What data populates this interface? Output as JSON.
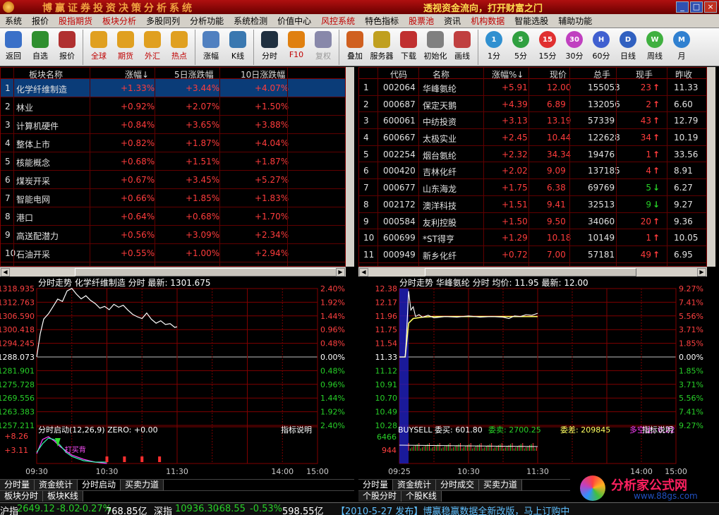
{
  "title": {
    "app": "博赢证券投资决策分析系统",
    "slogan": "透视资金流向，打开财富之门"
  },
  "window_buttons": [
    "_",
    "□",
    "×"
  ],
  "menu": [
    {
      "label": "系统",
      "red": false
    },
    {
      "label": "报价",
      "red": false
    },
    {
      "label": "股指期货",
      "red": true
    },
    {
      "label": "板块分析",
      "red": true
    },
    {
      "label": "多股同列",
      "red": false
    },
    {
      "label": "分析功能",
      "red": false
    },
    {
      "label": "系统检测",
      "red": false
    },
    {
      "label": "价值中心",
      "red": false
    },
    {
      "label": "风控系统",
      "red": true
    },
    {
      "label": "特色指标",
      "red": false
    },
    {
      "label": "股票池",
      "red": true
    },
    {
      "label": "资讯",
      "red": false
    },
    {
      "label": "机构数据",
      "red": true
    },
    {
      "label": "智能选股",
      "red": false
    },
    {
      "label": "辅助功能",
      "red": false
    }
  ],
  "toolbar": [
    {
      "label": "返回",
      "icon": "back-icon",
      "color": "#3a70c8"
    },
    {
      "label": "自选",
      "icon": "star-list-icon",
      "color": "#2f8f2f"
    },
    {
      "label": "报价",
      "icon": "quote-icon",
      "color": "#b03030"
    },
    {
      "sep": true
    },
    {
      "label": "全球",
      "icon": "globe-icon",
      "color": "#e0a020",
      "red": true
    },
    {
      "label": "期货",
      "icon": "futures-icon",
      "color": "#e0a020",
      "red": true
    },
    {
      "label": "外汇",
      "icon": "forex-icon",
      "color": "#e0a020",
      "red": true
    },
    {
      "label": "热点",
      "icon": "hot-icon",
      "color": "#e0a020",
      "red": true
    },
    {
      "sep": true
    },
    {
      "label": "涨幅",
      "icon": "rise-icon",
      "color": "#5080c0"
    },
    {
      "label": "K线",
      "icon": "kline-icon",
      "color": "#3a78b0"
    },
    {
      "sep": true
    },
    {
      "label": "分时",
      "icon": "intraday-icon",
      "color": "#203040"
    },
    {
      "label": "F10",
      "icon": "f10-icon",
      "color": "#e08010",
      "red": true
    },
    {
      "label": "复权",
      "icon": "restore-icon",
      "color": "#8888aa",
      "dim": true
    },
    {
      "sep": true
    },
    {
      "label": "叠加",
      "icon": "overlay-icon",
      "color": "#d06020"
    },
    {
      "label": "服务器",
      "icon": "server-icon",
      "color": "#c0a020"
    },
    {
      "label": "下载",
      "icon": "download-icon",
      "color": "#c03030"
    },
    {
      "label": "初始化",
      "icon": "init-icon",
      "color": "#808080"
    },
    {
      "label": "画线",
      "icon": "draw-line-icon",
      "color": "#c04040"
    },
    {
      "sep": true
    },
    {
      "label": "1分",
      "icon": "period-1-icon",
      "color": "#3090d0",
      "text": "1"
    },
    {
      "label": "5分",
      "icon": "period-5-icon",
      "color": "#30a040",
      "text": "5"
    },
    {
      "label": "15分",
      "icon": "period-15-icon",
      "color": "#e03030",
      "text": "15"
    },
    {
      "label": "30分",
      "icon": "period-30-icon",
      "color": "#c040c0",
      "text": "30"
    },
    {
      "label": "60分",
      "icon": "period-60-icon",
      "color": "#4060d0",
      "text": "H"
    },
    {
      "label": "日线",
      "icon": "period-day-icon",
      "color": "#3060c0",
      "text": "D"
    },
    {
      "label": "周线",
      "icon": "period-week-icon",
      "color": "#40b040",
      "text": "W"
    },
    {
      "label": "月",
      "icon": "period-month-icon",
      "color": "#3080d0",
      "text": "M"
    }
  ],
  "sector_table": {
    "headers": [
      "板块名称",
      "涨幅↓",
      "5日涨跌幅",
      "10日涨跌幅"
    ],
    "rows": [
      {
        "no": "1",
        "name": "化学纤维制造",
        "chg": "+1.33%",
        "chg5": "+3.44%",
        "chg10": "+4.07%"
      },
      {
        "no": "2",
        "name": "林业",
        "chg": "+0.92%",
        "chg5": "+2.07%",
        "chg10": "+1.50%"
      },
      {
        "no": "3",
        "name": "计算机硬件",
        "chg": "+0.84%",
        "chg5": "+3.65%",
        "chg10": "+3.88%"
      },
      {
        "no": "4",
        "name": "整体上市",
        "chg": "+0.82%",
        "chg5": "+1.87%",
        "chg10": "+4.04%"
      },
      {
        "no": "5",
        "name": "核能概念",
        "chg": "+0.68%",
        "chg5": "+1.51%",
        "chg10": "+1.87%"
      },
      {
        "no": "6",
        "name": "煤炭开采",
        "chg": "+0.67%",
        "chg5": "+3.45%",
        "chg10": "+5.27%"
      },
      {
        "no": "7",
        "name": "智能电网",
        "chg": "+0.66%",
        "chg5": "+1.85%",
        "chg10": "+1.83%"
      },
      {
        "no": "8",
        "name": "港口",
        "chg": "+0.64%",
        "chg5": "+0.68%",
        "chg10": "+1.70%"
      },
      {
        "no": "9",
        "name": "高送配潜力",
        "chg": "+0.56%",
        "chg5": "+3.09%",
        "chg10": "+2.34%"
      },
      {
        "no": "10",
        "name": "石油开采",
        "chg": "+0.55%",
        "chg5": "+1.00%",
        "chg10": "+2.94%"
      }
    ]
  },
  "stock_table": {
    "headers": [
      "代码",
      "名称",
      "涨幅%↓",
      "现价",
      "总手",
      "现手",
      "昨收"
    ],
    "rows": [
      {
        "no": "1",
        "code": "002064",
        "name": "华峰氨纶",
        "chg": "+5.91",
        "price": "12.00",
        "vol": "155053",
        "cur": "23",
        "dir": "up",
        "prev": "11.33"
      },
      {
        "no": "2",
        "code": "000687",
        "name": "保定天鹅",
        "chg": "+4.39",
        "price": "6.89",
        "vol": "132056",
        "cur": "2",
        "dir": "up",
        "prev": "6.60"
      },
      {
        "no": "3",
        "code": "600061",
        "name": "中纺投资",
        "chg": "+3.13",
        "price": "13.19",
        "vol": "57339",
        "cur": "43",
        "dir": "up",
        "prev": "12.79"
      },
      {
        "no": "4",
        "code": "600667",
        "name": "太极实业",
        "chg": "+2.45",
        "price": "10.44",
        "vol": "122628",
        "cur": "34",
        "dir": "up",
        "prev": "10.19"
      },
      {
        "no": "5",
        "code": "002254",
        "name": "烟台氨纶",
        "chg": "+2.32",
        "price": "34.34",
        "vol": "19476",
        "cur": "1",
        "dir": "up",
        "prev": "33.56"
      },
      {
        "no": "6",
        "code": "000420",
        "name": "吉林化纤",
        "chg": "+2.02",
        "price": "9.09",
        "vol": "137185",
        "cur": "4",
        "dir": "up",
        "prev": "8.91"
      },
      {
        "no": "7",
        "code": "000677",
        "name": "山东海龙",
        "chg": "+1.75",
        "price": "6.38",
        "vol": "69769",
        "cur": "5",
        "dir": "down",
        "prev": "6.27"
      },
      {
        "no": "8",
        "code": "002172",
        "name": "澳洋科技",
        "chg": "+1.51",
        "price": "9.41",
        "vol": "32513",
        "cur": "9",
        "dir": "down",
        "prev": "9.27"
      },
      {
        "no": "9",
        "code": "000584",
        "name": "友利控股",
        "chg": "+1.50",
        "price": "9.50",
        "vol": "34060",
        "cur": "20",
        "dir": "up",
        "prev": "9.36"
      },
      {
        "no": "10",
        "code": "600699",
        "name": "*ST得亨",
        "chg": "+1.29",
        "price": "10.18",
        "vol": "10149",
        "cur": "1",
        "dir": "up",
        "prev": "10.05"
      },
      {
        "no": "11",
        "code": "000949",
        "name": "新乡化纤",
        "chg": "+0.72",
        "price": "7.00",
        "vol": "57181",
        "cur": "49",
        "dir": "up",
        "prev": "6.95"
      }
    ]
  },
  "left_chart": {
    "title": "分时走势  化学纤维制造  分时  最新: 1301.675",
    "y_left": [
      "1318.935",
      "1312.763",
      "1306.590",
      "1300.418",
      "1294.245",
      "1288.073",
      "1281.901",
      "1275.728",
      "1269.556",
      "1263.383",
      "1257.211"
    ],
    "y_right": [
      "2.40%",
      "1.92%",
      "1.44%",
      "0.96%",
      "0.48%",
      "0.00%",
      "0.48%",
      "0.96%",
      "1.44%",
      "1.92%",
      "2.40%"
    ],
    "sub_title": "分时启动(12,26,9)  ZERO: +0.00",
    "sub_link": "指标说明",
    "sub_y": [
      "+8.26",
      "+3.11"
    ],
    "x_labels": [
      "09:30",
      "10:30",
      "11:30",
      "14:00",
      "15:00"
    ],
    "annotation": "打买背",
    "series": {
      "name": "",
      "x_minutes": [
        0,
        3,
        6,
        10,
        14,
        18,
        22,
        26,
        30,
        34,
        38,
        42,
        46,
        50,
        54,
        58,
        62,
        66,
        70,
        74,
        78,
        82,
        86,
        90,
        94,
        98,
        102,
        106,
        110,
        114,
        118,
        120
      ],
      "values": [
        1288.1,
        1298.5,
        1305.2,
        1307.5,
        1310.8,
        1314.2,
        1313.1,
        1317.9,
        1319.0,
        1316.4,
        1314.3,
        1315.7,
        1313.6,
        1312.2,
        1310.1,
        1310.9,
        1309.4,
        1311.8,
        1310.5,
        1311.4,
        1309.2,
        1307.3,
        1306.2,
        1305.4,
        1307.9,
        1305.1,
        1303.3,
        1304.4,
        1302.7,
        1303.1,
        1301.4,
        1301.7
      ]
    }
  },
  "right_chart": {
    "title": "分时走势  华峰氨纶  分时  均价: 11.95  最新: 12.00",
    "y_left": [
      "12.38",
      "12.17",
      "11.96",
      "11.75",
      "11.54",
      "11.33",
      "11.12",
      "10.91",
      "10.70",
      "10.49",
      "10.28"
    ],
    "y_right": [
      "9.27%",
      "7.41%",
      "5.56%",
      "3.71%",
      "1.85%",
      "0.00%",
      "1.85%",
      "3.71%",
      "5.56%",
      "7.41%",
      "9.27%"
    ],
    "sub_title": "BUYSELL  委买: 601.80",
    "sub_ask": "委卖: 2700.25",
    "sub_diff": "委差: 209845",
    "sub_ratio": "多空比: 0.22",
    "sub_link": "指标说明",
    "sub_y": [
      "6466",
      "944"
    ],
    "x_labels": [
      "09:25",
      "10:30",
      "11:30",
      "14:00",
      "15:00"
    ],
    "series_price": {
      "name": "",
      "x_minutes": [
        0,
        5,
        6,
        8,
        10,
        12,
        14,
        17,
        20,
        25,
        30,
        40,
        50,
        60,
        70,
        80,
        90,
        95,
        100,
        105,
        110,
        115,
        120
      ],
      "values": [
        11.33,
        11.33,
        11.6,
        12.34,
        12.05,
        12.1,
        11.95,
        11.98,
        11.94,
        11.97,
        11.93,
        11.95,
        11.94,
        11.96,
        11.94,
        11.95,
        11.94,
        11.92,
        11.96,
        11.95,
        11.98,
        11.97,
        12.0
      ]
    },
    "series_avg": {
      "name": "",
      "x_minutes": [
        0,
        5,
        6,
        8,
        12,
        20,
        30,
        60,
        90,
        120
      ],
      "values": [
        11.33,
        11.33,
        11.5,
        11.85,
        11.92,
        11.94,
        11.95,
        11.95,
        11.95,
        11.95
      ]
    }
  },
  "left_tabs": [
    "分时量",
    "资金统计",
    "分时启动",
    "买卖力道"
  ],
  "left_tabs2": [
    "板块分时",
    "板块K线"
  ],
  "right_tabs": [
    "分时量",
    "资金统计",
    "分时成交",
    "买卖力道"
  ],
  "right_tabs2": [
    "个股分时",
    "个股K线"
  ],
  "status": {
    "sh_label": "沪指",
    "sh_value": "2649.12",
    "sh_chg": "-8.02",
    "sh_pct": "-0.27%",
    "sh_amt": "768.85亿",
    "sz_label": "深指",
    "sz_value": "10936.30",
    "sz_chg": "-68.55",
    "sz_pct": "-0.53%",
    "sz_amt": "598.55亿",
    "news": "【2010-5-27 发布】博赢稳赢数据全新改版，马上订购中"
  },
  "logo": {
    "text": "分析家公式网",
    "url": "www.88gs.com"
  },
  "colors": {
    "up": "#ff3c3c",
    "down": "#28d028",
    "grid": "#800000",
    "axis_text": "#ff4040",
    "price_line": "#ffffff",
    "avg_line": "#ffff60",
    "selected_row": "#0a3c78"
  }
}
